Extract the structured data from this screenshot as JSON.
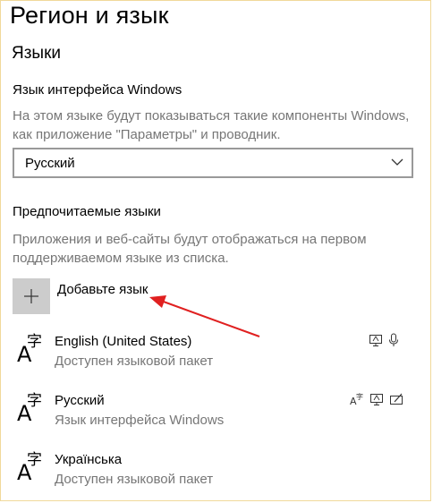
{
  "page": {
    "title": "Регион и язык"
  },
  "languages_section": {
    "title": "Языки",
    "display_language": {
      "label": "Язык интерфейса Windows",
      "description": "На этом языке будут показываться такие компоненты Windows, как приложение \"Параметры\" и проводник.",
      "selected": "Русский",
      "chevron_icon": "chevron-down-icon"
    },
    "preferred": {
      "title": "Предпочитаемые языки",
      "description": "Приложения и веб-сайты будут отображаться на первом поддерживаемом языке из списка.",
      "add_button": {
        "label": "Добавьте язык",
        "icon": "plus-icon"
      },
      "items": [
        {
          "name": "English (United States)",
          "status": "Доступен языковой пакет",
          "icon": "language-icon",
          "features": [
            "display-language-icon",
            "speech-icon"
          ]
        },
        {
          "name": "Русский",
          "status": "Язык интерфейса Windows",
          "icon": "language-icon",
          "features": [
            "text-to-speech-icon",
            "display-language-icon",
            "handwriting-icon"
          ]
        },
        {
          "name": "Українська",
          "status": "Доступен языковой пакет",
          "icon": "language-icon",
          "features": []
        }
      ]
    }
  },
  "colors": {
    "annotation_arrow": "#e02020",
    "add_tile": "#cccccc",
    "secondary_text": "#767676"
  }
}
